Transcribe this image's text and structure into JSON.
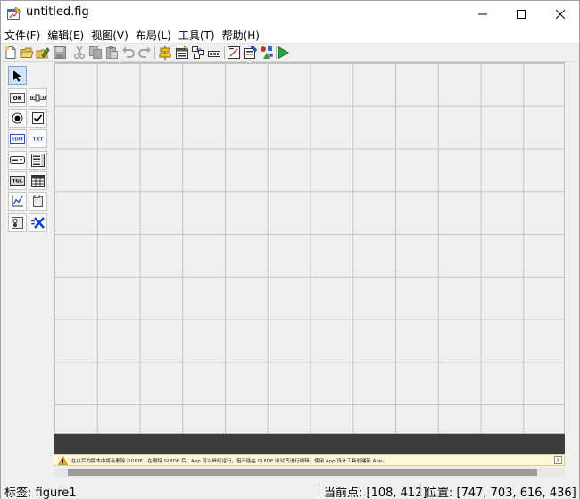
{
  "window": {
    "title": "untitled.fig",
    "icon": "figure-app-icon"
  },
  "menubar": {
    "items": [
      "文件(F)",
      "编辑(E)",
      "视图(V)",
      "布局(L)",
      "工具(T)",
      "帮助(H)"
    ]
  },
  "toolbar": {
    "buttons": [
      "new-file-icon",
      "open-file-icon",
      "edit-icon",
      "save-icon",
      "cut-icon",
      "copy-icon",
      "paste-icon",
      "undo-icon",
      "redo-icon",
      "align-objects-icon",
      "menu-editor-icon",
      "tab-order-editor-icon",
      "toolbar-editor-icon",
      "editor-icon",
      "property-inspector-icon",
      "object-browser-icon",
      "run-figure-icon"
    ]
  },
  "palette": {
    "tools": [
      "select-pointer-icon",
      "push-button-icon",
      "slider-icon",
      "radio-button-icon",
      "check-box-icon",
      "edit-text-icon",
      "static-text-icon",
      "popup-menu-icon",
      "listbox-icon",
      "toggle-button-icon",
      "table-icon",
      "axes-icon",
      "panel-icon",
      "button-group-icon",
      "activex-control-icon"
    ],
    "labels": {
      "push": "OK",
      "edit": "EDIT",
      "static": "TXT",
      "toggle": "TGL"
    }
  },
  "warning": {
    "text": "在以后的版本中将会删除 GUIDE - 在删除 GUIDE 后，App 可以继续运行，但不能在 GUIDE 中对其进行编辑。使用 App 设计工具创建新 App。"
  },
  "status": {
    "tag": "标签: figure1",
    "current_point": "当前点:  [108, 412]",
    "position": "位置: [747, 703, 616, 436]"
  },
  "colors": {
    "run": "#2ea043",
    "warning": "#f0b400",
    "selected": "#cfe3f6"
  }
}
